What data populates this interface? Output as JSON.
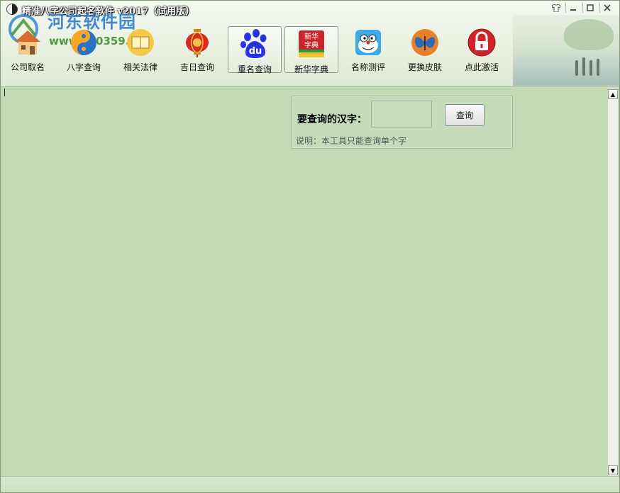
{
  "window": {
    "title": "精准八字公司起名软件 v2017（试用版）",
    "watermark_name": "河东软件园",
    "watermark_url": "www.pc0359.cn"
  },
  "toolbar": {
    "items": [
      {
        "label": "公司取名",
        "icon": "house-icon"
      },
      {
        "label": "八字查询",
        "icon": "yin-yang-icon"
      },
      {
        "label": "相关法律",
        "icon": "law-book-icon"
      },
      {
        "label": "吉日查询",
        "icon": "lantern-icon"
      },
      {
        "label": "重名查询",
        "icon": "baidu-paw-icon"
      },
      {
        "label": "新华字典",
        "icon": "dictionary-icon",
        "icon_text_top": "新华",
        "icon_text_bottom": "字典"
      },
      {
        "label": "名称测评",
        "icon": "robot-cat-icon"
      },
      {
        "label": "更换皮肤",
        "icon": "butterfly-icon"
      },
      {
        "label": "点此激活",
        "icon": "lock-icon"
      }
    ],
    "baidu_text": "du"
  },
  "panel": {
    "query_label": "要查询的汉字：",
    "query_value": "",
    "query_button": "查询",
    "hint": "说明：本工具只能查询单个字"
  },
  "colors": {
    "background": "#c2d9b4",
    "header": "#e8f0e0",
    "accent_blue": "#2d7fd0",
    "lock_red": "#d0242a"
  }
}
